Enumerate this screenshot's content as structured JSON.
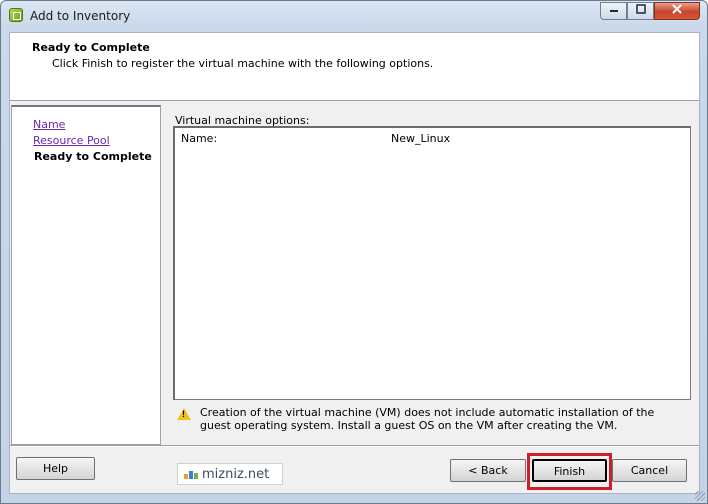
{
  "window": {
    "title": "Add to Inventory"
  },
  "header": {
    "title": "Ready to Complete",
    "subtitle": "Click Finish to register the virtual machine with the following options."
  },
  "nav": {
    "items": [
      {
        "label": "Name",
        "state": "link"
      },
      {
        "label": "Resource Pool",
        "state": "link"
      },
      {
        "label": "Ready to Complete",
        "state": "current"
      }
    ]
  },
  "options": {
    "label": "Virtual machine options:",
    "rows": [
      {
        "name": "Name:",
        "value": "New_Linux"
      }
    ]
  },
  "warning": {
    "icon": "warning-icon",
    "text": "Creation of the virtual machine (VM) does not include automatic installation of the guest operating system. Install a guest OS on the VM after creating the VM."
  },
  "buttons": {
    "help": "Help",
    "back": "< Back",
    "finish": "Finish",
    "cancel": "Cancel"
  },
  "watermark": {
    "text": "mizniz.net"
  },
  "colors": {
    "highlight": "#cc1f2b",
    "link": "#6a27b0"
  }
}
